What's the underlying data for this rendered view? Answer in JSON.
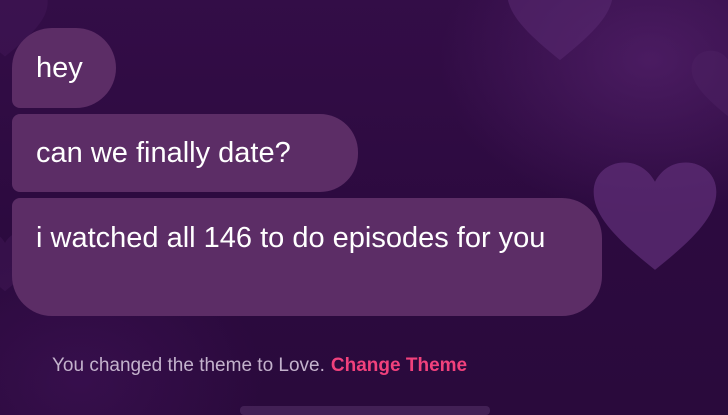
{
  "colors": {
    "background": "#2e0b40",
    "bubble": "#5c2d66",
    "bubble_text": "#ffffff",
    "notice_text": "#c3b2cc",
    "accent": "#f1417c",
    "heart": "#5a2a72"
  },
  "messages": [
    {
      "text": "hey"
    },
    {
      "text": "can we finally date?"
    },
    {
      "text": "i watched all 146 to do episodes for you"
    }
  ],
  "system_notice": {
    "text": "You changed the theme to Love.",
    "link_label": "Change Theme"
  },
  "background": {
    "theme_name": "Love",
    "decoration_icon": "heart-icon"
  }
}
